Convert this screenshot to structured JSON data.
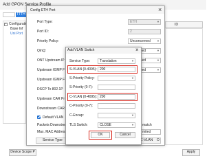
{
  "gpon_window": {
    "title": "Add GPON Service Profile",
    "profile_name_value": "TTTH",
    "tree_group": "Configuration",
    "tree_items": [
      "Base Inf",
      "Uni Port"
    ],
    "right_header": "ID",
    "bottom_buttons": [
      "Device Scope P",
      "Apply"
    ]
  },
  "eth_window": {
    "title": "Config ETH Port",
    "labels": [
      "Port Type:",
      "Port ID:",
      "Priority Policy:",
      "QinQ:",
      "ONT Upstream IP",
      "Upstream IGMP F",
      "Upstream IGMP F",
      "DSCP To 802.1P",
      "Upstream CAR Pr",
      "Downstream CAR",
      "Default VLAN",
      "Packets Downstream",
      "Max. MAC Address"
    ],
    "port_type_value": "ETH",
    "port_id_value": "2",
    "priority_policy_value": "Unconcerned",
    "right_values": [
      "nned",
      "nned",
      "nned"
    ],
    "right_tail": [
      "match",
      "mited"
    ],
    "table_headers": [
      "Service Type",
      "C-VLAN",
      "O"
    ]
  },
  "vlan_dialog": {
    "title": "Add VLAN Switch",
    "service_type_label": "Service Type:",
    "service_type_value": "Translation",
    "svlan_label": "S-VLAN (0-4095):",
    "svlan_value": "200",
    "s_priority_policy_label": "S-Priority Policy:",
    "s_priority_label": "S-Priority (0-7):",
    "cvlan_label": "C-VLAN (0-4095):",
    "cvlan_value": "200",
    "c_priority_label": "C-Priority (0-7):",
    "c_encap_label": "C-Encap:",
    "tls_switch_label": "TLS Switch:",
    "tls_switch_value": "CLOSE",
    "ok_label": "OK",
    "cancel_label": "Cancel"
  }
}
